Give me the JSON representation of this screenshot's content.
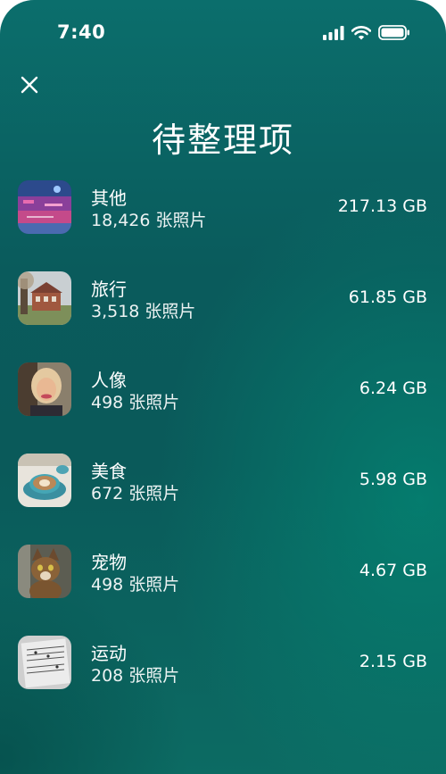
{
  "status": {
    "time": "7:40"
  },
  "icons": {
    "close": "close-icon",
    "signal": "signal-icon",
    "wifi": "wifi-icon",
    "battery": "battery-icon"
  },
  "title": "待整理项",
  "items": [
    {
      "name": "其他",
      "count": "18,426 张照片",
      "size": "217.13 GB",
      "thumb": "misc-photo-thumbnail"
    },
    {
      "name": "旅行",
      "count": "3,518 张照片",
      "size": "61.85 GB",
      "thumb": "travel-photo-thumbnail"
    },
    {
      "name": "人像",
      "count": "498 张照片",
      "size": "6.24 GB",
      "thumb": "portrait-photo-thumbnail"
    },
    {
      "name": "美食",
      "count": "672 张照片",
      "size": "5.98 GB",
      "thumb": "food-photo-thumbnail"
    },
    {
      "name": "宠物",
      "count": "498 张照片",
      "size": "4.67 GB",
      "thumb": "pet-photo-thumbnail"
    },
    {
      "name": "运动",
      "count": "208 张照片",
      "size": "2.15 GB",
      "thumb": "sports-photo-thumbnail"
    }
  ]
}
